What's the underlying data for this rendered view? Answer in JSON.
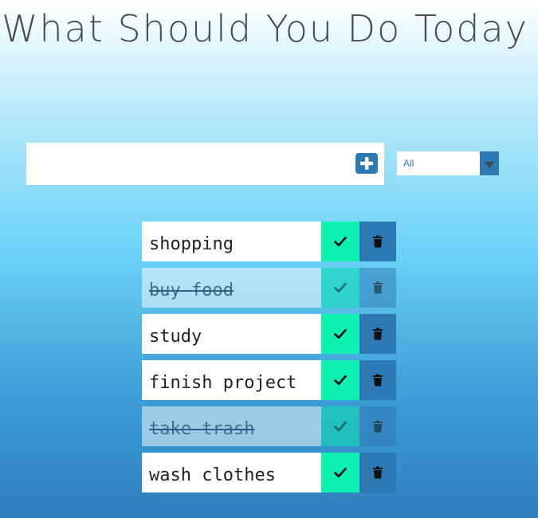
{
  "header": {
    "title": "What Should You Do Today"
  },
  "form": {
    "input_value": "",
    "input_placeholder": "",
    "add_icon": "plus-square-icon",
    "filter": {
      "selected": "All"
    }
  },
  "todos": [
    {
      "text": "shopping",
      "completed": false
    },
    {
      "text": "buy food",
      "completed": true
    },
    {
      "text": "study",
      "completed": false
    },
    {
      "text": "finish project",
      "completed": false
    },
    {
      "text": "take trash",
      "completed": true
    },
    {
      "text": "wash clothes",
      "completed": false
    }
  ],
  "icons": {
    "complete": "check-icon",
    "delete": "trash-icon"
  },
  "colors": {
    "accent": "#2e78b3",
    "complete": "#0ff0b3",
    "title_text": "#4a4a4a"
  }
}
